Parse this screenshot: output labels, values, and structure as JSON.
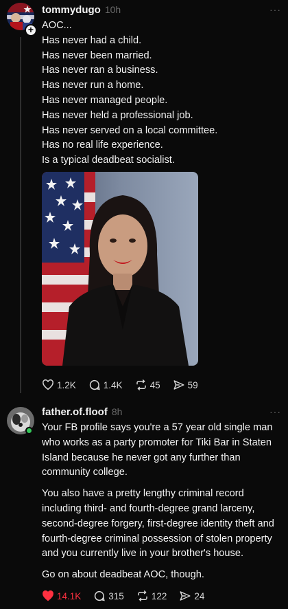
{
  "post1": {
    "username": "tommydugo",
    "time": "10h",
    "more": "···",
    "lines": [
      "AOC...",
      "Has never had a child.",
      "Has never been married.",
      "Has never ran a business.",
      "Has never run a home.",
      "Has never managed people.",
      "Has never held a professional job.",
      "Has never served on a local committee.",
      "Has no real life experience.",
      "Is a typical deadbeat socialist."
    ],
    "likes": "1.2K",
    "comments": "1.4K",
    "reposts": "45",
    "shares": "59"
  },
  "post2": {
    "username": "father.of.floof",
    "time": "8h",
    "more": "···",
    "paragraphs": [
      "Your FB profile says you're a 57 year old single man who works as a party promoter for Tiki Bar in Staten Island because he never got any further than community college.",
      "You also have a pretty lengthy criminal record including third- and fourth-degree grand larceny, second-degree forgery, first-degree identity theft and fourth-degree criminal possession of stolen property and you currently live in your brother's house.",
      "Go on about deadbeat AOC, though."
    ],
    "likes": "14.1K",
    "comments": "315",
    "reposts": "122",
    "shares": "24",
    "liked": true
  },
  "icons": {
    "heart": "heart-icon",
    "comment": "comment-icon",
    "repost": "repost-icon",
    "share": "share-icon",
    "add": "+"
  },
  "colors": {
    "background": "#0a0a0a",
    "text": "#f3f3f3",
    "muted": "#6a6a6a",
    "liked": "#ff3040",
    "online": "#35c75a"
  }
}
